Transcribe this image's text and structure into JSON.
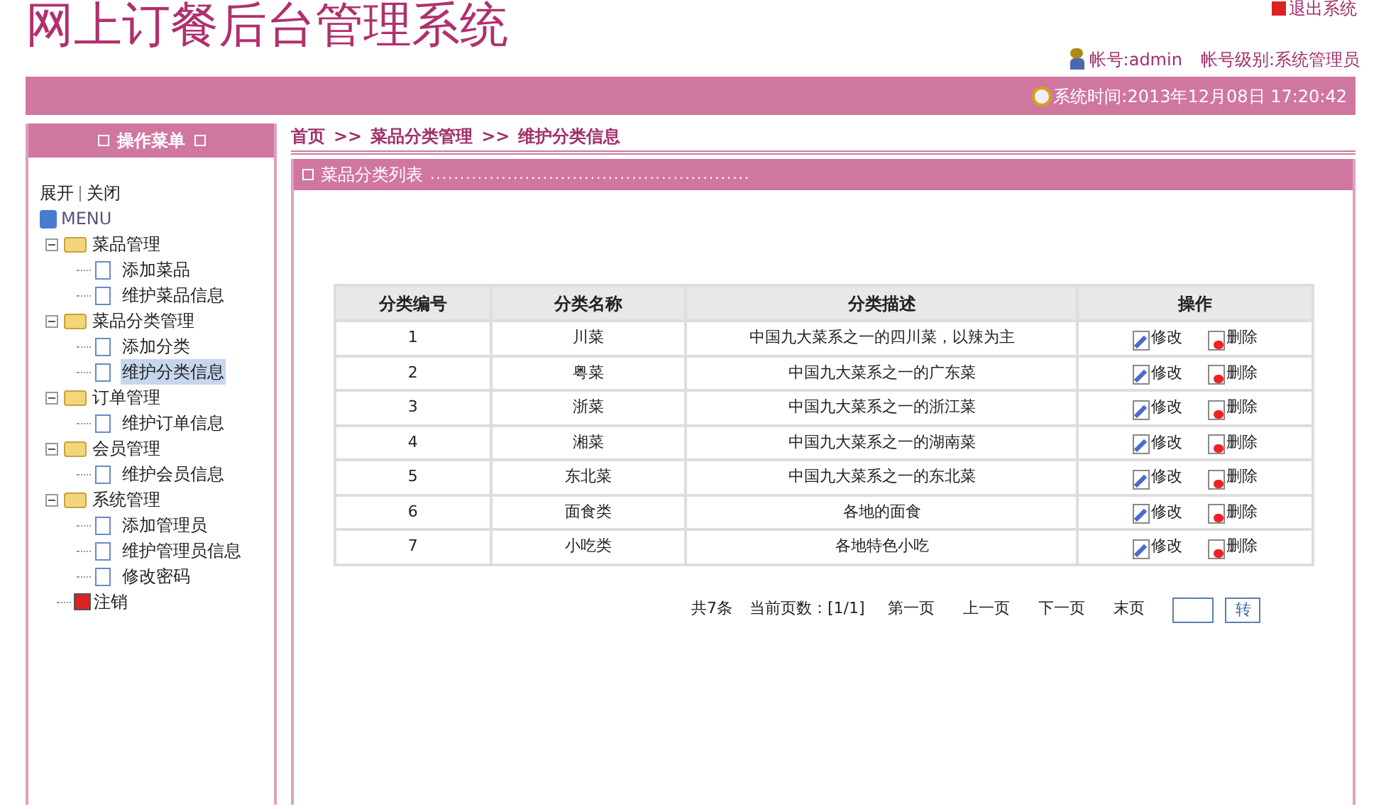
{
  "header": {
    "title": "网上订餐后台管理系统",
    "logout": "退出系统",
    "account": "帐号:admin",
    "account_level": "帐号级别:系统管理员",
    "system_time": "系统时间:2013年12月08日 17:20:42"
  },
  "sidebar": {
    "title": "操作菜单",
    "expand": "展开",
    "collapse": "关闭",
    "root": "MENU",
    "items": [
      {
        "label": "菜品管理",
        "expanded": true,
        "children": [
          {
            "label": "添加菜品",
            "selected": false
          },
          {
            "label": "维护菜品信息",
            "selected": false
          }
        ]
      },
      {
        "label": "菜品分类管理",
        "expanded": true,
        "children": [
          {
            "label": "添加分类",
            "selected": false
          },
          {
            "label": "维护分类信息",
            "selected": true
          }
        ]
      },
      {
        "label": "订单管理",
        "expanded": true,
        "children": [
          {
            "label": "维护订单信息",
            "selected": false
          }
        ]
      },
      {
        "label": "会员管理",
        "expanded": true,
        "children": [
          {
            "label": "维护会员信息",
            "selected": false
          }
        ]
      },
      {
        "label": "系统管理",
        "expanded": true,
        "children": [
          {
            "label": "添加管理员",
            "selected": false
          },
          {
            "label": "维护管理员信息",
            "selected": false
          },
          {
            "label": "修改密码",
            "selected": false
          }
        ]
      }
    ],
    "logout": "注销"
  },
  "breadcrumb": [
    "首页",
    ">>",
    "菜品分类管理",
    ">>",
    "维护分类信息"
  ],
  "panel": {
    "title": "菜品分类列表",
    "dots": "......................................................"
  },
  "table": {
    "columns": [
      "分类编号",
      "分类名称",
      "分类描述",
      "操作"
    ],
    "rows": [
      {
        "id": "1",
        "name": "川菜",
        "description": "中国九大菜系之一的四川菜，以辣为主",
        "edit": "修改",
        "delete": "删除"
      },
      {
        "id": "2",
        "name": "粤菜",
        "description": "中国九大菜系之一的广东菜",
        "edit": "修改",
        "delete": "删除"
      },
      {
        "id": "3",
        "name": "浙菜",
        "description": "中国九大菜系之一的浙江菜",
        "edit": "修改",
        "delete": "删除"
      },
      {
        "id": "4",
        "name": "湘菜",
        "description": "中国九大菜系之一的湖南菜",
        "edit": "修改",
        "delete": "删除"
      },
      {
        "id": "5",
        "name": "东北菜",
        "description": "中国九大菜系之一的东北菜",
        "edit": "修改",
        "delete": "删除"
      },
      {
        "id": "6",
        "name": "面食类",
        "description": "各地的面食",
        "edit": "修改",
        "delete": "删除"
      },
      {
        "id": "7",
        "name": "小吃类",
        "description": "各地特色小吃",
        "edit": "修改",
        "delete": "删除"
      }
    ]
  },
  "pagination": {
    "total": "共7条",
    "current": "当前页数：[1/1]",
    "first": "第一页",
    "prev": "上一页",
    "next": "下一页",
    "last": "末页",
    "go": "转"
  }
}
